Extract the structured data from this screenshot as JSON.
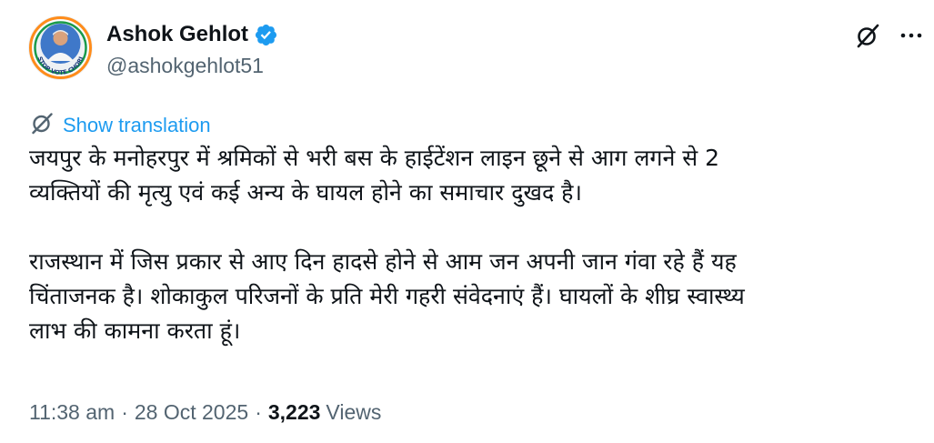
{
  "author": {
    "display_name": "Ashok Gehlot",
    "handle": "@ashokgehlot51",
    "verified_icon": "verified-badge-icon",
    "avatar_badge_text": "STOP VOTE CHORI"
  },
  "actions": {
    "grok_icon": "grok-icon",
    "more_icon": "more-horizontal-icon"
  },
  "translation": {
    "icon": "translate-globe-icon",
    "label": "Show translation"
  },
  "tweet": {
    "paragraph_1": "जयपुर के मनोहरपुर में श्रमिकों से भरी बस के हाईटेंशन लाइन छूने से आग लगने से 2\nव्यक्तियों की मृत्यु एवं कई अन्य के घायल होने का समाचार दुखद है।",
    "paragraph_2": "राजस्थान में जिस प्रकार से आए दिन हादसे होने से आम जन अपनी जान गंवा रहे हैं यह\nचिंताजनक है। शोकाकुल परिजनों के प्रति मेरी गहरी संवेदनाएं हैं। घायलों के शीघ्र स्वास्थ्य\nलाभ की कामना करता हूं।"
  },
  "meta": {
    "time": "11:38 am",
    "separator": "·",
    "date": "28 Oct 2025",
    "views_count": "3,223",
    "views_label": "Views"
  },
  "colors": {
    "accent": "#1d9bf0",
    "text_primary": "#0f1419",
    "text_secondary": "#536471"
  }
}
